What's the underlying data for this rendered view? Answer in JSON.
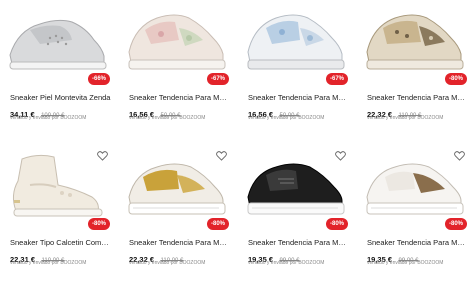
{
  "colors": {
    "badge": "#e2232a",
    "price": "#111111",
    "old_price": "#888888"
  },
  "products": [
    {
      "title": "Sneaker Piel Montevita Zenda",
      "price": "34,11 €",
      "old_price": "100,00 €",
      "discount": "-66%",
      "seller": "vendido y enviado por BOOZOOM",
      "wishlist_icon": false
    },
    {
      "title": "Sneaker Tendencia Para Muje...",
      "price": "16,56 €",
      "old_price": "50,00 €",
      "discount": "-67%",
      "seller": "vendido y enviado por BOOZOOM",
      "wishlist_icon": false
    },
    {
      "title": "Sneaker Tendencia Para Muje...",
      "price": "16,56 €",
      "old_price": "50,00 €",
      "discount": "-67%",
      "seller": "vendido y enviado por BOOZOOM",
      "wishlist_icon": false
    },
    {
      "title": "Sneaker Tendencia Para Muje...",
      "price": "22,32 €",
      "old_price": "110,00 €",
      "discount": "-80%",
      "seller": "vendido y enviado por BOOZOOM",
      "wishlist_icon": false
    },
    {
      "title": "Sneaker Tipo Calcetin Comod...",
      "price": "22,31 €",
      "old_price": "110,00 €",
      "discount": "-80%",
      "seller": "vendido y enviado por BOOZOOM",
      "wishlist_icon": true
    },
    {
      "title": "Sneaker Tendencia Para Muje...",
      "price": "22,32 €",
      "old_price": "110,00 €",
      "discount": "-80%",
      "seller": "vendido y enviado por BOOZOOM",
      "wishlist_icon": true
    },
    {
      "title": "Sneaker Tendencia Para Muje...",
      "price": "19,35 €",
      "old_price": "99,00 €",
      "discount": "-80%",
      "seller": "vendido y enviado por BOOZOOM",
      "wishlist_icon": true
    },
    {
      "title": "Sneaker Tendencia Para Muje...",
      "price": "19,35 €",
      "old_price": "99,00 €",
      "discount": "-80%",
      "seller": "vendido y enviado por BOOZOOM",
      "wishlist_icon": true
    }
  ]
}
